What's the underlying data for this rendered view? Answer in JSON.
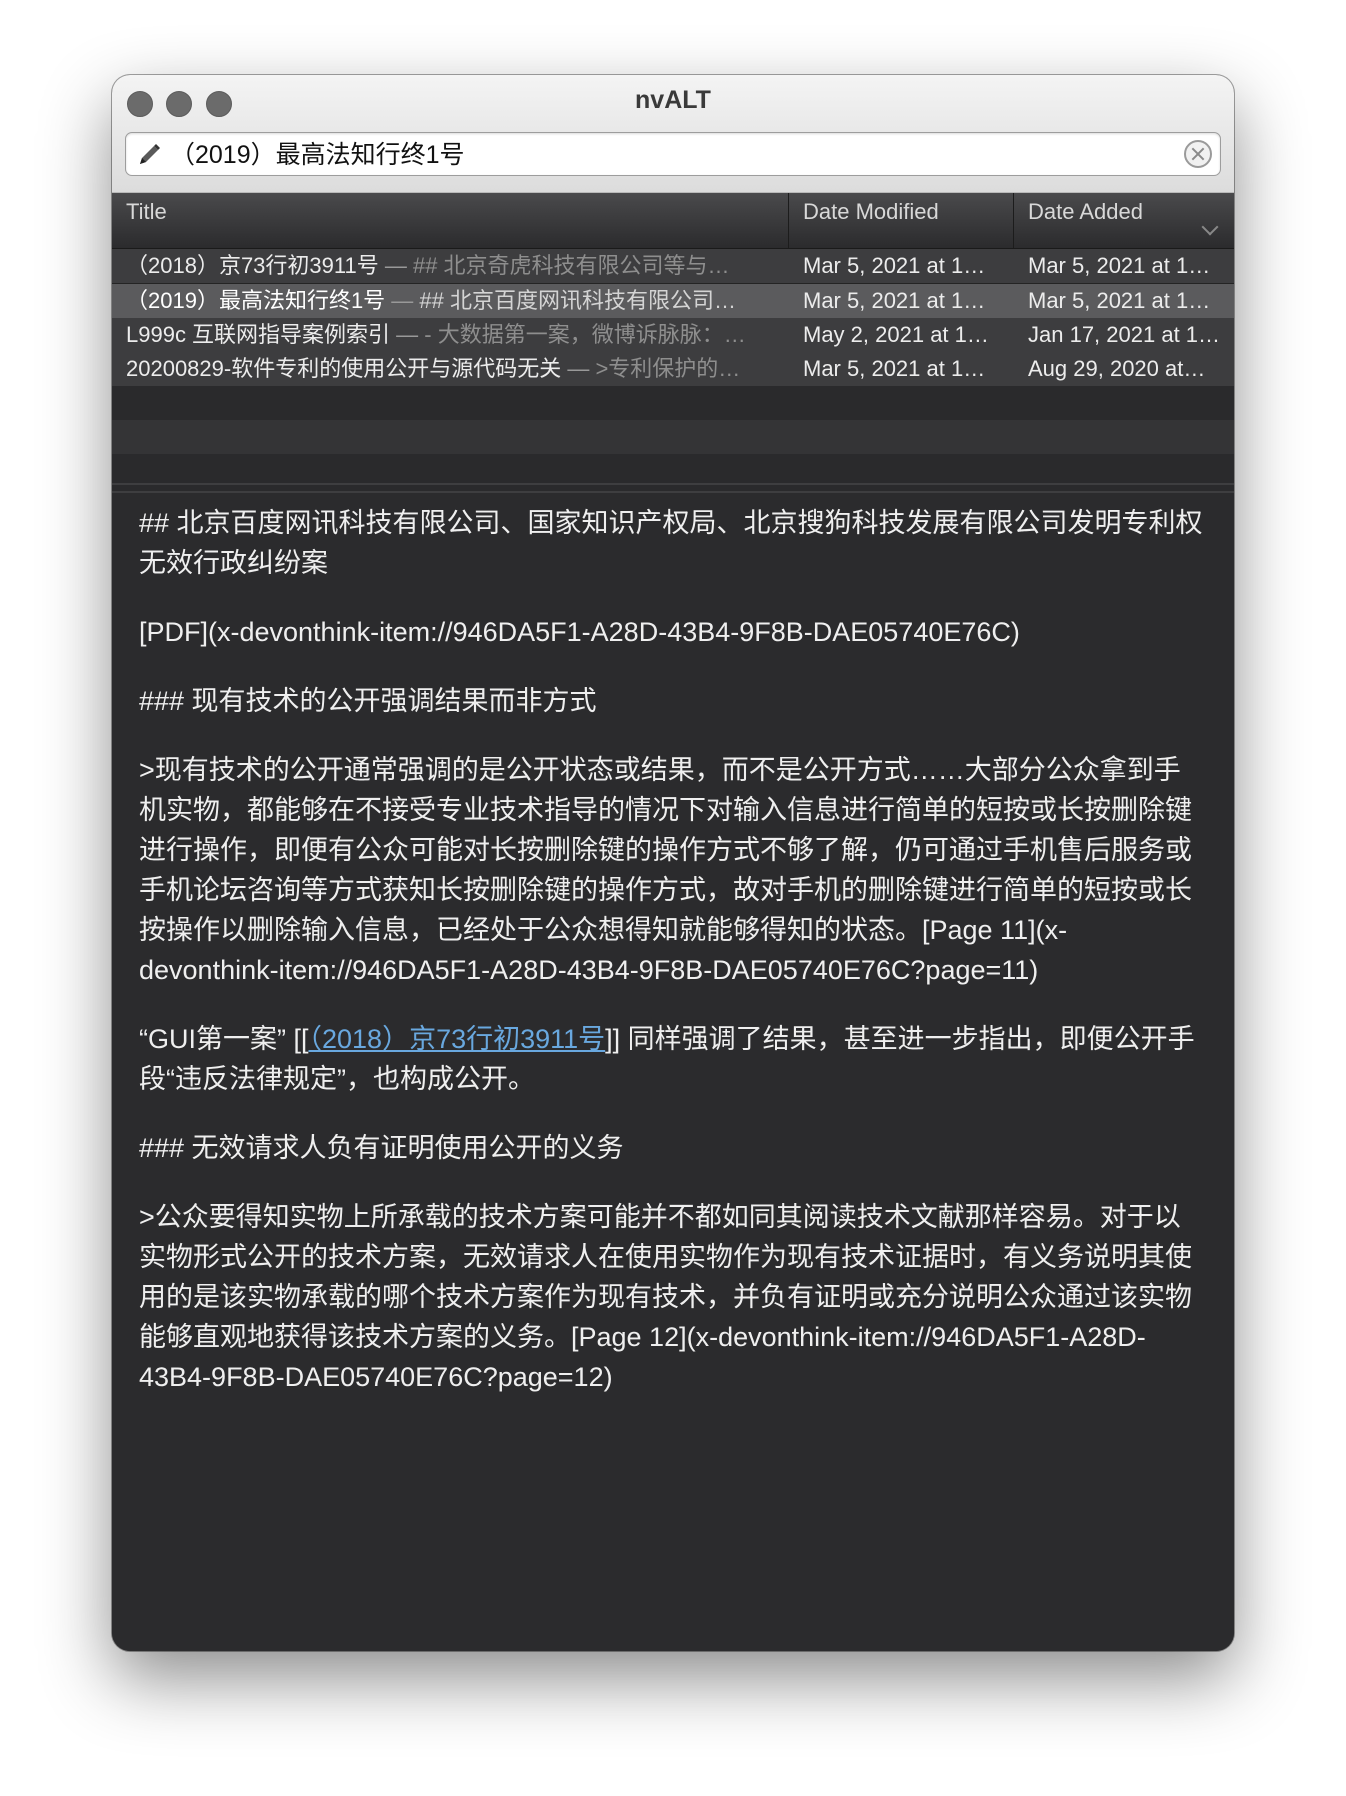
{
  "window": {
    "app_title": "nvALT"
  },
  "search": {
    "value": "（2019）最高法知行终1号"
  },
  "columns": {
    "title": "Title",
    "modified": "Date Modified",
    "added": "Date Added"
  },
  "notes": [
    {
      "title": "（2018）京73行初3911号",
      "separator": " — ",
      "preview": "## 北京奇虎科技有限公司等与…",
      "modified": "Mar 5, 2021 at 1…",
      "added": "Mar 5, 2021 at 1…"
    },
    {
      "title": "（2019）最高法知行终1号",
      "separator": " — ",
      "preview": "## 北京百度网讯科技有限公司…",
      "modified": "Mar 5, 2021 at 1…",
      "added": "Mar 5, 2021 at 1…"
    },
    {
      "title": "L999c 互联网指导案例索引",
      "separator": " — ",
      "preview": "- 大数据第一案，微博诉脉脉：…",
      "modified": "May 2, 2021 at 1…",
      "added": "Jan 17, 2021 at 1…"
    },
    {
      "title": "20200829-软件专利的使用公开与源代码无关",
      "separator": " — ",
      "preview": ">专利保护的…",
      "modified": "Mar 5, 2021 at 1…",
      "added": "Aug 29, 2020 at…"
    }
  ],
  "editor": {
    "heading": "## 北京百度网讯科技有限公司、国家知识产权局、北京搜狗科技发展有限公司发明专利权无效行政纠纷案",
    "pdf_link": "[PDF](x-devonthink-item://946DA5F1-A28D-43B4-9F8B-DAE05740E76C)",
    "section1": "### 现有技术的公开强调结果而非方式",
    "quote1": ">现有技术的公开通常强调的是公开状态或结果，而不是公开方式……大部分公众拿到手机实物，都能够在不接受专业技术指导的情况下对输入信息进行简单的短按或长按删除键进行操作，即便有公众可能对长按删除键的操作方式不够了解，仍可通过手机售后服务或手机论坛咨询等方式获知长按删除键的操作方式，故对手机的删除键进行简单的短按或长按操作以删除输入信息，已经处于公众想得知就能够得知的状态。[Page 11](x-devonthink-item://946DA5F1-A28D-43B4-9F8B-DAE05740E76C?page=11)",
    "gui_before": "“GUI第一案” [[",
    "gui_link": "（2018）京73行初3911号",
    "gui_after": "]] 同样强调了结果，甚至进一步指出，即便公开手段“违反法律规定”，也构成公开。",
    "section2": "### 无效请求人负有证明使用公开的义务",
    "quote2": ">公众要得知实物上所承载的技术方案可能并不都如同其阅读技术文献那样容易。对于以实物形式公开的技术方案，无效请求人在使用实物作为现有技术证据时，有义务说明其使用的是该实物承载的哪个技术方案作为现有技术，并负有证明或充分说明公众通过该实物能够直观地获得该技术方案的义务。[Page 12](x-devonthink-item://946DA5F1-A28D-43B4-9F8B-DAE05740E76C?page=12)"
  },
  "colors": {
    "link": "#69a8df",
    "editor_bg": "#2b2b2d",
    "selected_row": "#5b5b5d"
  },
  "icons": {
    "search_left": "pencil-icon",
    "search_right": "clear-icon",
    "sort": "chevron-down-icon"
  }
}
